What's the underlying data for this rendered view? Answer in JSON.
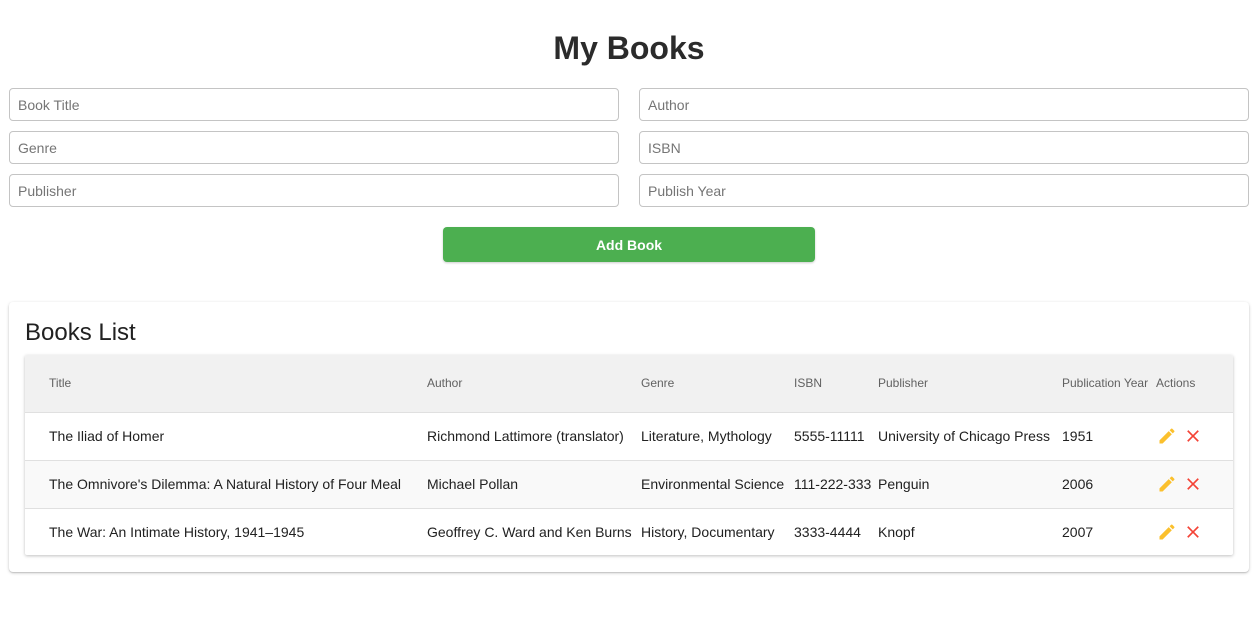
{
  "header": {
    "title": "My Books"
  },
  "form": {
    "book_title_placeholder": "Book Title",
    "author_placeholder": "Author",
    "genre_placeholder": "Genre",
    "isbn_placeholder": "ISBN",
    "publisher_placeholder": "Publisher",
    "publish_year_placeholder": "Publish Year",
    "add_button_label": "Add Book"
  },
  "list": {
    "title": "Books List",
    "columns": [
      "Title",
      "Author",
      "Genre",
      "ISBN",
      "Publisher",
      "Publication Year",
      "Actions"
    ],
    "rows": [
      {
        "title": "The Iliad of Homer",
        "author": "Richmond Lattimore (translator)",
        "genre": "Literature, Mythology",
        "isbn": "5555-11111",
        "publisher": "University of Chicago Press",
        "year": "1951"
      },
      {
        "title": "The Omnivore's Dilemma: A Natural History of Four Meal",
        "author": "Michael Pollan",
        "genre": "Environmental Science",
        "isbn": "111-222-333",
        "publisher": "Penguin",
        "year": "2006"
      },
      {
        "title": "The War: An Intimate History, 1941–1945",
        "author": "Geoffrey C. Ward and Ken Burns",
        "genre": "History, Documentary",
        "isbn": "3333-4444",
        "publisher": "Knopf",
        "year": "2007"
      }
    ]
  },
  "icons": {
    "edit": "pencil-icon",
    "delete": "close-icon"
  },
  "colors": {
    "primary_button": "#4caf50",
    "edit_icon": "#fbc02d",
    "delete_icon": "#f44336"
  }
}
